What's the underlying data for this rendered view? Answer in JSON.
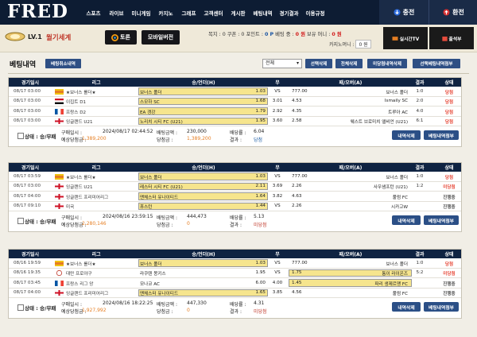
{
  "header": {
    "logo": "FRED",
    "nav": [
      "스포츠",
      "라이브",
      "미니게임",
      "카지노",
      "그래프",
      "고객센터",
      "게시판",
      "베팅내역",
      "경기결과",
      "이용규정"
    ],
    "charge": "충전",
    "withdraw": "환전"
  },
  "member": {
    "level": "LV.1",
    "nickname": "월기세계",
    "toon_btn": "토론",
    "mobile_btn": "모바일버전",
    "stats_line": "목지 : 0  쿠폰 : 0 포인트 : 0 P  베팅 중 : 0 원  보유 머니 : 0 원",
    "stats_parts": {
      "label1": "목지 : 0  쿠폰 : 0 포인트 : ",
      "points": "0 P",
      "label2": "  베팅 중 : ",
      "betting": "0 원",
      "label3": "  보유 머니 : ",
      "money": "0 원"
    },
    "casino_label": "카지노머니 :",
    "casino_value": "0 원",
    "live_tv": "실시간TV",
    "attendance": "출석부"
  },
  "toolbar": {
    "title": "베팅내역",
    "cancel_history": "베팅취소내역",
    "select_value": "전체",
    "select_delete": "선택삭제",
    "delete_all": "전체삭제",
    "delete_finished": "미당첨내역삭제",
    "select_submit": "선택베팅내역첨부"
  },
  "columns": {
    "date": "경기일시",
    "league": "리그",
    "home": "승/언더(H)",
    "draw": "무",
    "away": "패/오버(A)",
    "result": "결과",
    "status": "상태"
  },
  "blocks": [
    {
      "rows": [
        {
          "date": "08/17 03:00",
          "league": "★보너스 롤더★",
          "flag": "bonus",
          "home": "보너스 폴더",
          "home_sel": true,
          "hodd": "1.03",
          "draw": "VS",
          "away": "777.00",
          "away_name": "보너스 폴더",
          "away_sel": false,
          "result": "1:0",
          "status": "당첨"
        },
        {
          "date": "08/17 03:00",
          "league": "이집트 D1",
          "flag": "egypt",
          "home": "스모하 SC",
          "home_sel": true,
          "hodd": "1.68",
          "draw": "3.01",
          "away": "4.53",
          "away_name": "Ismaily SC",
          "away_sel": false,
          "result": "2:0",
          "status": "당첨"
        },
        {
          "date": "08/17 03:00",
          "league": "프랑스 D2",
          "flag": "france",
          "home": "EA 갱강",
          "home_sel": true,
          "hodd": "1.79",
          "draw": "2.92",
          "away": "4.35",
          "away_name": "트루아 AC",
          "away_sel": false,
          "result": "4:0",
          "status": "당첨"
        },
        {
          "date": "08/17 03:00",
          "league": "잉글랜드 U21",
          "flag": "england",
          "home": "노리치 시티 FC (U21)",
          "home_sel": true,
          "hodd": "1.95",
          "draw": "3.60",
          "away": "2.58",
          "away_name": "웨스트 브로미치 앨비언 (U21)",
          "away_sel": false,
          "result": "6:1",
          "status": "당첨"
        }
      ],
      "status_label": "상태 : 승/무패",
      "buy_label": "구매일시 :",
      "buy_value": "2024/08/17 02:44:52",
      "amount_label": "배팅금액 :",
      "amount_value": "230,000",
      "odds_label": "배당률 :",
      "odds_value": "6.04",
      "expect_label": "예상당첨금 :",
      "expect_value": "1,389,200",
      "win_label": "당첨금 :",
      "win_value": "1,389,200",
      "result_label": "결과 :",
      "result_value": "당첨",
      "del_btn": "내역삭제",
      "submit_btn": "베팅내역첨부"
    },
    {
      "rows": [
        {
          "date": "08/17 03:59",
          "league": "★보너스 롤더★",
          "flag": "bonus",
          "home": "보너스 폴더",
          "home_sel": true,
          "hodd": "1.03",
          "draw": "VS",
          "away": "777.00",
          "away_name": "보너스 폴더",
          "away_sel": false,
          "result": "1:0",
          "status": "당첨"
        },
        {
          "date": "08/17 03:00",
          "league": "잉글랜드 U21",
          "flag": "england",
          "home": "레스터 시티 FC (U21)",
          "home_sel": true,
          "hodd": "2.11",
          "draw": "3.69",
          "away": "2.26",
          "away_name": "사우샘프턴 (U21)",
          "away_sel": false,
          "result": "1:2",
          "status": "미당첨"
        },
        {
          "date": "08/17 04:00",
          "league": "잉글랜드 프리미어리그",
          "flag": "england",
          "home": "맨체스터 유나이티드",
          "home_sel": true,
          "hodd": "1.64",
          "draw": "3.82",
          "away": "4.63",
          "away_name": "풀럼 FC",
          "away_sel": false,
          "result": "",
          "status": "진행중"
        },
        {
          "date": "08/17 09:10",
          "league": "미국",
          "flag": "england",
          "home": "휴스턴",
          "home_sel": true,
          "hodd": "1.44",
          "draw": "VS",
          "away": "2.26",
          "away_name": "시카고W",
          "away_sel": false,
          "result": "",
          "status": "진행중"
        }
      ],
      "status_label": "상태 : 승/무패",
      "buy_label": "구매일시 :",
      "buy_value": "2024/08/16 23:59:15",
      "amount_label": "배팅금액 :",
      "amount_value": "444,473",
      "odds_label": "배당률 :",
      "odds_value": "5.13",
      "expect_label": "예상당첨금 :",
      "expect_value": "2,280,146",
      "win_label": "당첨금 :",
      "win_value": "0",
      "result_label": "결과 :",
      "result_value": "미당첨",
      "del_btn": "내역삭제",
      "submit_btn": "베팅내역첨부"
    },
    {
      "rows": [
        {
          "date": "08/16 19:59",
          "league": "★보너스 롤더★",
          "flag": "bonus",
          "home": "보너스 폴더",
          "home_sel": true,
          "hodd": "1.03",
          "draw": "VS",
          "away": "777.00",
          "away_name": "보너스 폴더",
          "away_sel": false,
          "result": "1:0",
          "status": "당첨"
        },
        {
          "date": "08/16 19:35",
          "league": "대만 프로야구",
          "flag": "baseball",
          "home": "라쿠텐 몽키스",
          "home_sel": false,
          "hodd": "1.95",
          "draw": "VS",
          "away": "1.75",
          "away_name": "퉁이 라이온즈",
          "away_sel": true,
          "result": "5:2",
          "status": "미당첨"
        },
        {
          "date": "08/17 03:45",
          "league": "프랑스 리그 앙",
          "flag": "france",
          "home": "모나코 AC",
          "home_sel": false,
          "hodd": "6.00",
          "draw": "4.00",
          "away": "1.45",
          "away_name": "파리 생제르맹 FC",
          "away_sel": true,
          "result": "",
          "status": "진행중"
        },
        {
          "date": "08/17 04:00",
          "league": "잉글랜드 프리미어리그",
          "flag": "england",
          "home": "맨체스터 유나이티드",
          "home_sel": true,
          "hodd": "1.65",
          "draw": "3.85",
          "away": "4.56",
          "away_name": "풀럼 FC",
          "away_sel": false,
          "result": "",
          "status": "진행중"
        }
      ],
      "status_label": "상태 : 승/무패",
      "buy_label": "구매일시 :",
      "buy_value": "2024/08/16 18:22:25",
      "amount_label": "배팅금액 :",
      "amount_value": "447,330",
      "odds_label": "배당률 :",
      "odds_value": "4.31",
      "expect_label": "예상당첨금 :",
      "expect_value": "1,927,992",
      "win_label": "당첨금 :",
      "win_value": "0",
      "result_label": "결과 :",
      "result_value": "미당첨",
      "del_btn": "내역삭제",
      "submit_btn": "베팅내역첨부"
    }
  ]
}
